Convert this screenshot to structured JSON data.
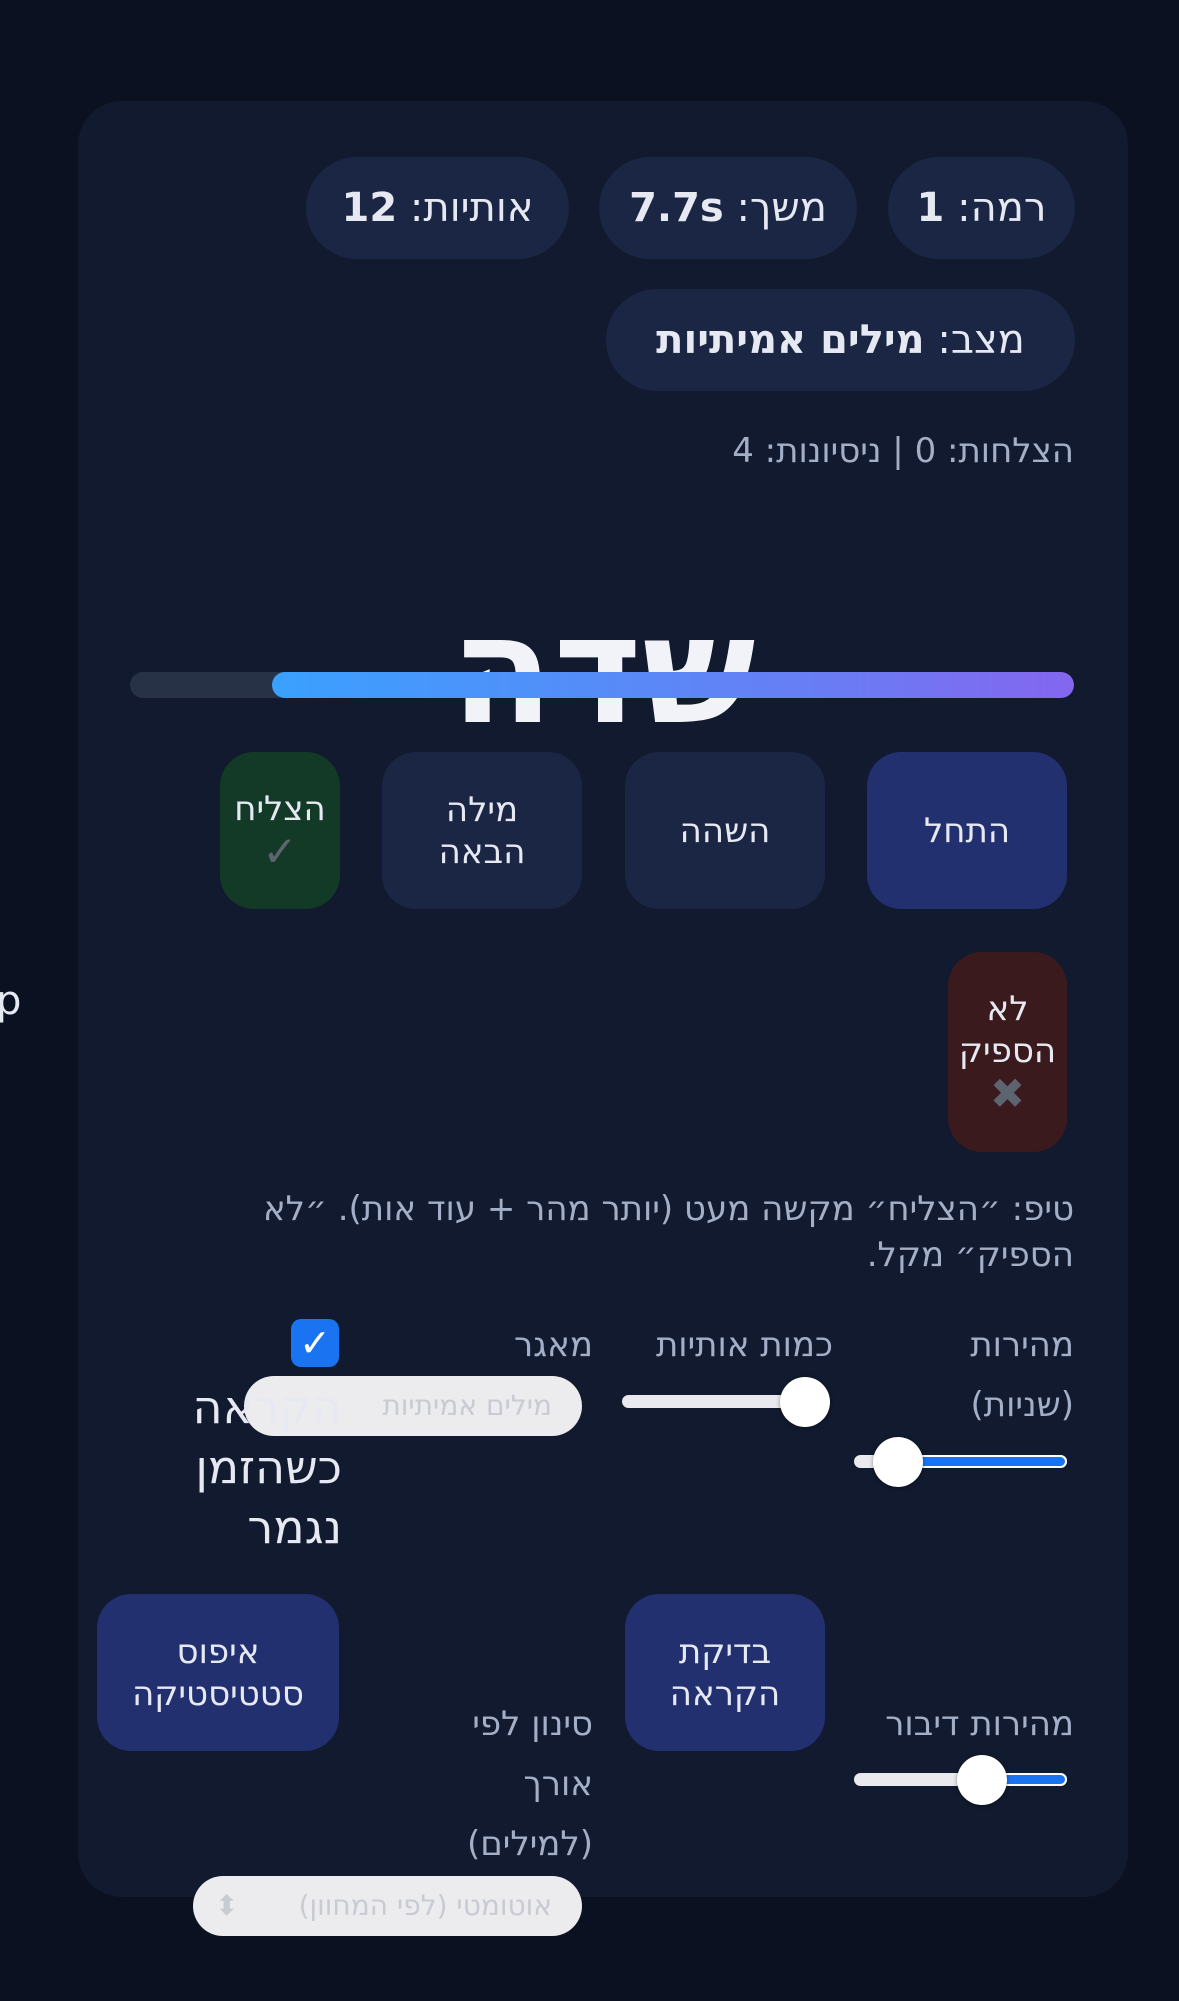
{
  "edge_char": "p",
  "header": {
    "level_label": "רמה:",
    "level_value": "1",
    "duration_label": "משך:",
    "duration_value": "7.7s",
    "letters_label": "אותיות:",
    "letters_value": "12",
    "mode_label": "מצב:",
    "mode_value": "מילים אמיתיות"
  },
  "stats_line": "הצלחות: 0 | ניסיונות: 4",
  "current_word": "שדה",
  "progress": {
    "remaining_fraction": 0.85
  },
  "buttons": {
    "start": "התחל",
    "pause": "השהה",
    "next_word_line1": "מילה",
    "next_word_line2": "הבאה",
    "success": "הצליח",
    "success_mark": "✓",
    "fail_line1": "לא",
    "fail_line2": "הספיק",
    "fail_mark": "✖",
    "test_tts_line1": "בדיקת",
    "test_tts_line2": "הקראה",
    "reset_stats_line1": "איפוס",
    "reset_stats_line2": "סטטיסטיקה"
  },
  "tip": "טיפ: ״הצליח״ מקשה מעט (יותר מהר + עוד אות). ״לא הספיק״ מקל.",
  "controls": {
    "speed_label_line1": "מהירות",
    "speed_label_line2": "(שניות)",
    "speed_value": 0.9,
    "letters_label": "כמות אותיות",
    "letters_value": 0.1,
    "pool_label": "מאגר",
    "pool_value": "מילים אמיתיות",
    "read_when_done_checked": true,
    "read_when_done_label_line1": "הקראה",
    "read_when_done_label_line2": "כשהזמן",
    "read_when_done_label_line3": "נגמר",
    "speech_rate_label": "מהירות דיבור",
    "speech_rate_value": 0.45,
    "length_filter_label_line1": "סינון לפי",
    "length_filter_label_line2": "אורך",
    "length_filter_label_line3": "(למילים)",
    "length_filter_value": "אוטומטי (לפי המחוון)"
  },
  "colors": {
    "background": "#0b1120",
    "card": "#111a2e",
    "pill": "#1b2644",
    "accent_blue": "#233070",
    "success_green": "#123a26",
    "fail_red": "#3b1a1d",
    "slider_blue": "#1a73f0"
  }
}
